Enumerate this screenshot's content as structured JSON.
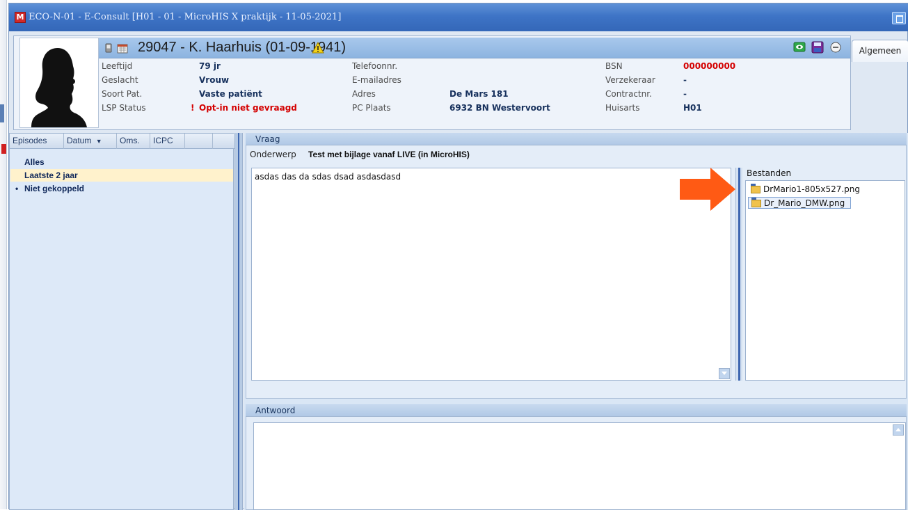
{
  "window": {
    "app_icon": "M",
    "title": "ECO-N-01 - E-Consult   [H01 - 01 - MicroHIS X praktijk - 11-05-2021]"
  },
  "patient": {
    "header_name": "29047 - K. Haarhuis (01-09-1941)",
    "labels": {
      "leeftijd": "Leeftijd",
      "geslacht": "Geslacht",
      "soort_pat": "Soort Pat.",
      "lsp_status": "LSP Status",
      "telefoonnr": "Telefoonnr.",
      "emailadres": "E-mailadres",
      "adres": "Adres",
      "pc_plaats": "PC Plaats",
      "bsn": "BSN",
      "verzekeraar": "Verzekeraar",
      "contractnr": "Contractnr.",
      "huisarts": "Huisarts"
    },
    "values": {
      "leeftijd": "79 jr",
      "geslacht": "Vrouw",
      "soort_pat": "Vaste patiënt",
      "lsp_status_mark": "!",
      "lsp_status": "Opt-in niet gevraagd",
      "telefoonnr": "",
      "emailadres": "",
      "adres": "De Mars 181",
      "pc_plaats": "6932 BN  Westervoort",
      "bsn": "000000000",
      "verzekeraar": "-",
      "contractnr": "-",
      "huisarts": "H01"
    },
    "icons": [
      "phone-icon",
      "calendar-icon",
      "warning-icon",
      "eye-icon",
      "save-icon",
      "collapse-icon"
    ],
    "colors": {
      "alert_red": "#d40000",
      "warning_yellow": "#f3d21a"
    }
  },
  "tabs": {
    "algemeen": "Algemeen"
  },
  "episodes": {
    "columns": [
      "Episodes",
      "Datum",
      "Oms.",
      "ICPC"
    ],
    "sort_indicator": "▼",
    "rows": [
      {
        "label": "Alles",
        "bullet": ""
      },
      {
        "label": "Laatste 2 jaar",
        "bullet": ""
      },
      {
        "label": "Niet gekoppeld",
        "bullet": "•"
      }
    ],
    "selected_row": "Laatste 2 jaar"
  },
  "vraag": {
    "group_title": "Vraag",
    "onderwerp_label": "Onderwerp",
    "onderwerp_value": "Test met bijlage vanaf LIVE (in MicroHIS)",
    "body": "asdas das da sdas dsad asdasdasd",
    "bestanden_label": "Bestanden",
    "files": [
      "DrMario1-805x527.png",
      "Dr_Mario_DMW.png"
    ],
    "selected_file": "Dr_Mario_DMW.png",
    "annotation_arrow_color": "#ff5a14"
  },
  "antwoord": {
    "group_title": "Antwoord",
    "body": ""
  }
}
